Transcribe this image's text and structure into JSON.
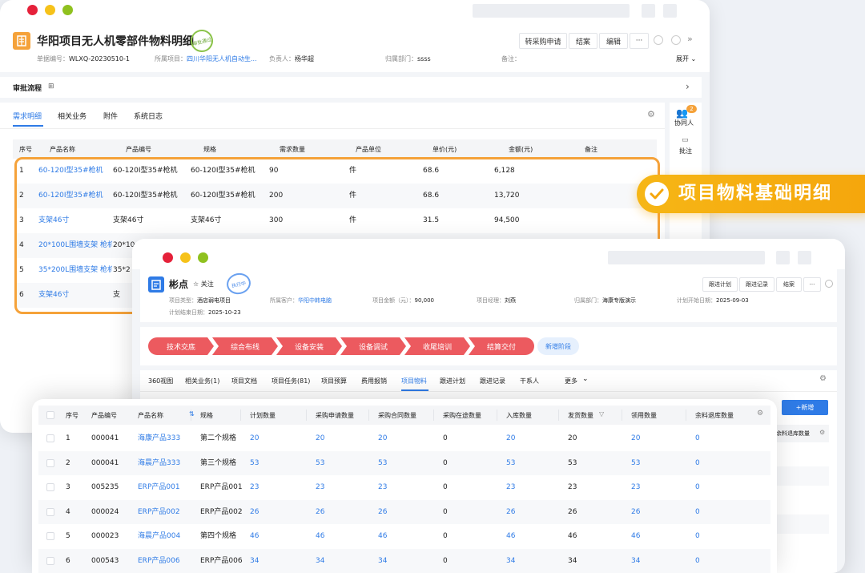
{
  "win1": {
    "title": "华阳项目无人机零部件物料明细",
    "stamp_text": "审批通过",
    "meta": [
      {
        "label": "单据编号：",
        "value": "WLXQ-20230510-1"
      },
      {
        "label": "所属项目：",
        "value": "四川华阳无人机自动生..."
      },
      {
        "label": "负责人：",
        "value": "杨华超"
      },
      {
        "label": "归属部门：",
        "value": "ssss"
      },
      {
        "label": "备注：",
        "value": ""
      }
    ],
    "buttons": [
      "转采购申请",
      "结案",
      "编辑",
      "···"
    ],
    "expand_label": "展开",
    "approval_label": "审批流程",
    "tabs": [
      "需求明细",
      "相关业务",
      "附件",
      "系统日志"
    ],
    "side_items": [
      {
        "label": "协同人",
        "badge": "2"
      },
      {
        "label": "批注",
        "badge": ""
      }
    ],
    "table": {
      "headers": [
        "序号",
        "产品名称",
        "产品编号",
        "规格",
        "需求数量",
        "产品单位",
        "单价(元)",
        "金额(元)",
        "备注"
      ],
      "rows": [
        [
          "1",
          "60-120Ⅰ型35#枪机",
          "60-120Ⅰ型35#枪机",
          "60-120Ⅰ型35#枪机",
          "90",
          "件",
          "68.6",
          "6,128",
          ""
        ],
        [
          "2",
          "60-120Ⅰ型35#枪机",
          "60-120Ⅰ型35#枪机",
          "60-120Ⅰ型35#枪机",
          "200",
          "件",
          "68.6",
          "13,720",
          ""
        ],
        [
          "3",
          "支架46寸",
          "支架46寸",
          "支架46寸",
          "300",
          "件",
          "31.5",
          "94,500",
          ""
        ],
        [
          "4",
          "20*100L围墙支架 枪机",
          "20*10",
          "",
          "",
          "",
          "",
          "",
          ""
        ],
        [
          "5",
          "35*200L围墙支架 枪机",
          "35*2",
          "",
          "",
          "",
          "",
          "",
          ""
        ],
        [
          "6",
          "支架46寸",
          "支",
          "",
          "",
          "",
          "",
          "",
          ""
        ]
      ]
    }
  },
  "badge": {
    "text": "项目物料基础明细"
  },
  "win2": {
    "title": "彬点",
    "follow_label": "关注",
    "stamp_text": "执行中",
    "meta": [
      {
        "label": "项目类型：",
        "value": "酒店弱电项目"
      },
      {
        "label": "所属客户：",
        "value": "华阳中韩电脑"
      },
      {
        "label": "项目金额（元）：",
        "value": "90,000"
      },
      {
        "label": "项目经理：",
        "value": "刘燕"
      },
      {
        "label": "归属部门：",
        "value": "海康专版演示"
      },
      {
        "label": "计划开始日期：",
        "value": "2025-09-03"
      },
      {
        "label": "计划结束日期：",
        "value": "2025-10-23"
      }
    ],
    "buttons": [
      "跟进计划",
      "跟进记录",
      "结案",
      "···"
    ],
    "stages": [
      "技术交底",
      "综合布线",
      "设备安装",
      "设备调试",
      "收尾培训",
      "结算交付"
    ],
    "add_stage": "新增阶段",
    "tabs": [
      "360视图",
      "相关业务(1)",
      "项目文档",
      "项目任务(81)",
      "项目预算",
      "费用报销",
      "项目物料",
      "跟进计划",
      "跟进记录",
      "干系人",
      "更多"
    ],
    "add_button": "+新增",
    "behind_header": "余料退库数量"
  },
  "materials": {
    "headers": [
      "序号",
      "产品编号",
      "产品名称",
      "规格",
      "计划数量",
      "采购申请数量",
      "采购合同数量",
      "采购在途数量",
      "入库数量",
      "发货数量",
      "领用数量",
      "余料退库数量"
    ],
    "rows": [
      [
        "1",
        "000041",
        "海康产品333",
        "第二个规格",
        "20",
        "20",
        "20",
        "0",
        "20",
        "20",
        "20",
        "0"
      ],
      [
        "2",
        "000041",
        "海晨产品333",
        "第三个规格",
        "53",
        "53",
        "53",
        "0",
        "53",
        "53",
        "53",
        "0"
      ],
      [
        "3",
        "005235",
        "ERP产品001",
        "ERP产品001",
        "23",
        "23",
        "23",
        "0",
        "23",
        "23",
        "23",
        "0"
      ],
      [
        "4",
        "000024",
        "ERP产品002",
        "ERP产品002",
        "26",
        "26",
        "26",
        "0",
        "26",
        "26",
        "26",
        "0"
      ],
      [
        "5",
        "000023",
        "海晨产品004",
        "第四个规格",
        "46",
        "46",
        "46",
        "0",
        "46",
        "46",
        "46",
        "0"
      ],
      [
        "6",
        "000543",
        "ERP产品006",
        "ERP产品006",
        "34",
        "34",
        "34",
        "0",
        "34",
        "34",
        "34",
        "0"
      ]
    ]
  },
  "colors": {
    "accent": "#2f7be6",
    "orange": "#f5a60c",
    "stage": "#ec5a5f"
  }
}
